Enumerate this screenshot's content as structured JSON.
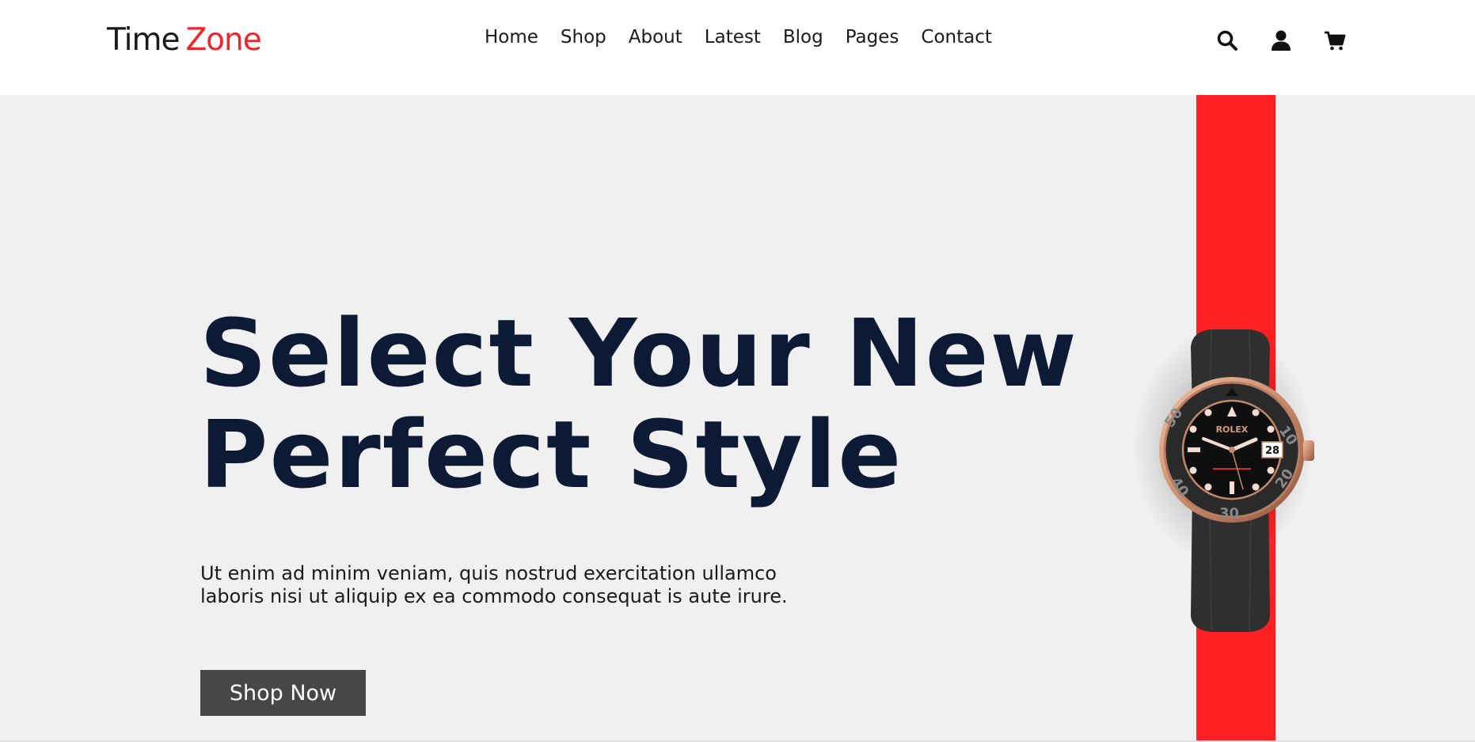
{
  "header": {
    "logo": {
      "part1": "Time",
      "part2": "Zone"
    },
    "nav": [
      "Home",
      "Shop",
      "About",
      "Latest",
      "Blog",
      "Pages",
      "Contact"
    ],
    "icons": [
      "search-icon",
      "user-icon",
      "cart-icon"
    ]
  },
  "hero": {
    "headline": [
      "Select Your New",
      "Perfect Style"
    ],
    "description": [
      "Ut enim ad minim veniam, quis nostrud exercitation ullamco",
      "laboris nisi ut aliquip ex ea commodo consequat is aute irure."
    ],
    "button": "Shop Now",
    "watch": {
      "brand": "ROLEX",
      "date": "28"
    }
  },
  "colors": {
    "brand_red": "#f0262b",
    "stripe_red": "#fe2023",
    "headline": "#0c1a36",
    "button_bg": "#474747",
    "hero_bg": "#f0f0f0"
  }
}
